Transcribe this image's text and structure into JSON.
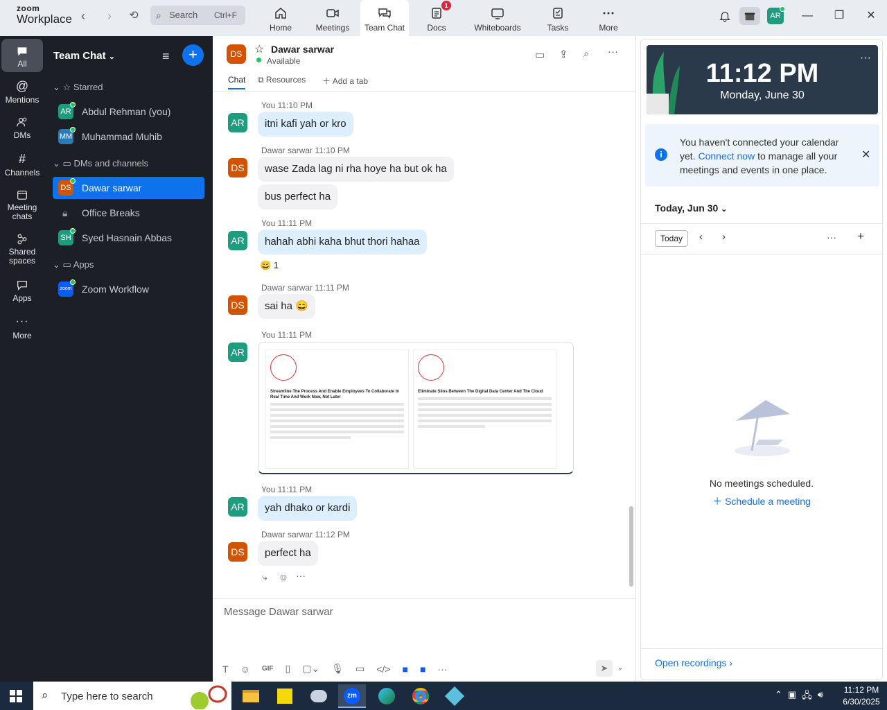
{
  "app": {
    "logo_top": "zoom",
    "logo_bottom": "Workplace"
  },
  "search": {
    "label": "Search",
    "shortcut": "Ctrl+F"
  },
  "tabs": [
    {
      "label": "Home",
      "icon": "home-icon"
    },
    {
      "label": "Meetings",
      "icon": "video-icon"
    },
    {
      "label": "Team Chat",
      "icon": "chat-icon"
    },
    {
      "label": "Docs",
      "icon": "doc-icon",
      "badge": "1"
    },
    {
      "label": "Whiteboards",
      "icon": "whiteboard-icon"
    },
    {
      "label": "Tasks",
      "icon": "tasks-icon"
    },
    {
      "label": "More",
      "icon": "more-icon"
    }
  ],
  "user_avatar": "AR",
  "rail": [
    {
      "label": "All"
    },
    {
      "label": "Mentions"
    },
    {
      "label": "DMs"
    },
    {
      "label": "Channels"
    },
    {
      "label": "Meeting chats"
    },
    {
      "label": "Shared spaces"
    },
    {
      "label": "Apps"
    },
    {
      "label": "More"
    }
  ],
  "sidebar": {
    "title": "Team Chat",
    "starred": "Starred",
    "dms": "DMs and channels",
    "apps": "Apps",
    "items": [
      {
        "initials": "AR",
        "name": "Abdul Rehman (you)",
        "color": "#1e9c7e"
      },
      {
        "initials": "MM",
        "name": "Muhammad Muhib",
        "color": "#2b7bb9"
      },
      {
        "initials": "DS",
        "name": "Dawar sarwar",
        "color": "#d35400"
      },
      {
        "initials": "",
        "name": "Office Breaks",
        "color": ""
      },
      {
        "initials": "SH",
        "name": "Syed Hasnain Abbas",
        "color": "#1e9c7e"
      },
      {
        "initials": "zoom",
        "name": "Zoom Workflow",
        "color": "#0b5cff"
      }
    ]
  },
  "chat": {
    "contact_initials": "DS",
    "contact_name": "Dawar sarwar",
    "status": "Available",
    "tabs": [
      "Chat",
      "Resources",
      "Add a tab"
    ],
    "messages": [
      {
        "meta": "You 11:10 PM",
        "initials": "AR",
        "text": "itni kafi yah or kro"
      },
      {
        "meta": "Dawar sarwar 11:10 PM",
        "initials": "DS",
        "text": "wase Zada lag ni rha hoye ha but ok ha",
        "text2": "bus perfect ha"
      },
      {
        "meta": "You 11:11 PM",
        "initials": "AR",
        "text": "hahah abhi kaha bhut thori hahaa",
        "reaction": "😄 1"
      },
      {
        "meta": "Dawar sarwar 11:11 PM",
        "initials": "DS",
        "text": "sai ha 😄"
      },
      {
        "meta": "You 11:11 PM",
        "initials": "AR",
        "card1_title": "Streamline The Process And Enable Employees To Collaborate In Real Time And Work Now, Not Later",
        "card2_title": "Eliminate Silos Between The Digital Data Center And The Cloud"
      },
      {
        "meta": "You 11:11 PM",
        "initials": "AR",
        "text": "yah dhako or kardi"
      },
      {
        "meta": "Dawar sarwar 11:12 PM",
        "initials": "DS",
        "text": "perfect ha"
      }
    ],
    "composer_placeholder": "Message Dawar sarwar"
  },
  "calendar": {
    "time": "11:12 PM",
    "date": "Monday, June 30",
    "notice_pre": "You haven't connected your calendar yet. ",
    "notice_link": "Connect now",
    "notice_post": " to manage all your meetings and events in one place.",
    "day_header": "Today, Jun 30",
    "today_button": "Today",
    "empty_text": "No meetings scheduled.",
    "schedule_link": "Schedule a meeting",
    "recordings_link": "Open recordings"
  },
  "taskbar": {
    "search_placeholder": "Type here to search",
    "time": "11:12 PM",
    "date": "6/30/2025"
  }
}
